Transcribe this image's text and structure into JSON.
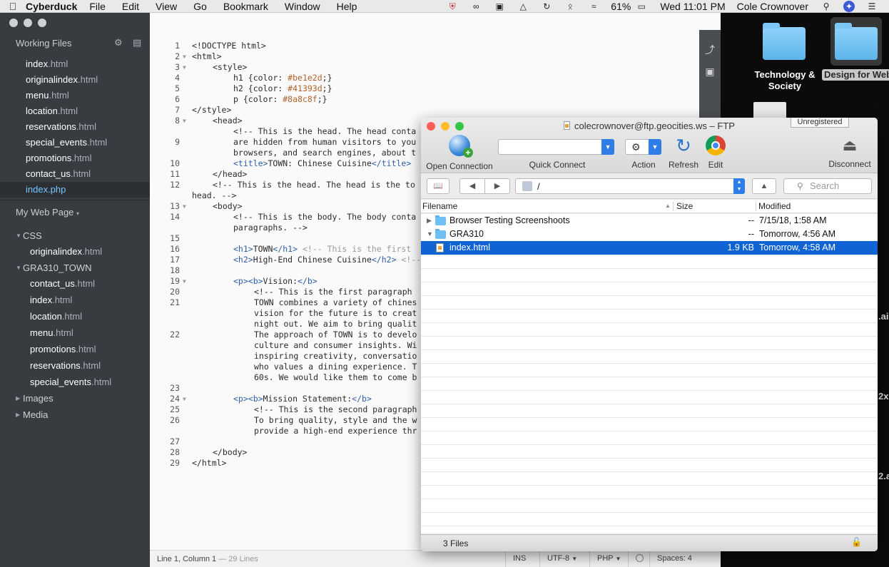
{
  "menubar": {
    "app": "Cyberduck",
    "items": [
      "File",
      "Edit",
      "View",
      "Go",
      "Bookmark",
      "Window",
      "Help"
    ],
    "battery": "61%",
    "clock": "Wed 11:01 PM",
    "user": "Cole Crownover"
  },
  "desktop": {
    "folders": [
      {
        "label_line1": "Technology &",
        "label_line2": "Society"
      },
      {
        "label": "Design for Web"
      }
    ],
    "edge_fragments": [
      ".ai",
      "2x",
      "2.ai"
    ]
  },
  "sidebar": {
    "working_files_title": "Working Files",
    "working_files": [
      {
        "name": "index",
        "ext": ".html"
      },
      {
        "name": "originalindex",
        "ext": ".html"
      },
      {
        "name": "menu",
        "ext": ".html"
      },
      {
        "name": "location",
        "ext": ".html"
      },
      {
        "name": "reservations",
        "ext": ".html"
      },
      {
        "name": "special_events",
        "ext": ".html"
      },
      {
        "name": "promotions",
        "ext": ".html"
      },
      {
        "name": "contact_us",
        "ext": ".html"
      },
      {
        "name": "index",
        "ext": ".php"
      }
    ],
    "project_title": "My Web Page",
    "groups": {
      "css": {
        "label": "CSS",
        "files": [
          {
            "name": "originalindex",
            "ext": ".html"
          }
        ]
      },
      "gra": {
        "label": "GRA310_TOWN",
        "files": [
          {
            "name": "contact_us",
            "ext": ".html"
          },
          {
            "name": "index",
            "ext": ".html"
          },
          {
            "name": "location",
            "ext": ".html"
          },
          {
            "name": "menu",
            "ext": ".html"
          },
          {
            "name": "promotions",
            "ext": ".html"
          },
          {
            "name": "reservations",
            "ext": ".html"
          },
          {
            "name": "special_events",
            "ext": ".html"
          }
        ]
      },
      "images": {
        "label": "Images"
      },
      "media": {
        "label": "Media"
      }
    }
  },
  "code": {
    "l1": "<!DOCTYPE html>",
    "l2": "<html>",
    "l3": "<style>",
    "l4a": "h1 {color: ",
    "l4b": "#be1e2d",
    "l4c": ";}",
    "l5a": "h2 {color: ",
    "l5b": "#41393d",
    "l5c": ";}",
    "l6a": "p {color: ",
    "l6b": "#8a8c8f",
    "l6c": ";}",
    "l7": "</style>",
    "l8": "<head>",
    "l9a": "<!-- This is the head. The head conta",
    "l9b": "are hidden from human visitors to you",
    "l9c": "browsers, and search engines, about t",
    "l10a": "<title>",
    "l10b": "TOWN: Chinese Cuisine",
    "l10c": "</title>",
    "l11": "</head>",
    "l12a": "<!-- This is the head. The head is the to",
    "l12b": "head. -->",
    "l13": "<body>",
    "l14a": "<!-- This is the body. The body conta",
    "l14b": "paragraphs. -->",
    "l16a": "<h1>",
    "l16b": "TOWN",
    "l16c": "</h1>",
    "l16d": " <!-- This is the first",
    "l17a": "<h2>",
    "l17b": "High-End Chinese Cuisine",
    "l17c": "</h2>",
    "l17d": " <!--",
    "l19a": "<p><b>",
    "l19b": "Vision:",
    "l19c": "</b>",
    "l20": "<!-- This is the first paragraph",
    "l21a": "TOWN combines a variety of chines",
    "l21b": "vision for the future is to creat",
    "l21c": "night out. We aim to bring qualit",
    "l22a": "The approach of TOWN is to develo",
    "l22b": "culture and consumer insights. Wi",
    "l22c": "inspiring creativity, conversatio",
    "l22d": "who values a dining experience. T",
    "l22e": "60s. We would like them to come b",
    "l24a": "<p><b>",
    "l24b": "Mission Statement:",
    "l24c": "</b>",
    "l25": "<!-- This is the second paragraph",
    "l26a": "To bring quality, style and the w",
    "l26b": "provide a high-end experience thr",
    "l28": "</body>",
    "l29": "</html>"
  },
  "editor_status": {
    "position": "Line 1, Column 1",
    "lines": "— 29 Lines",
    "mode": "INS",
    "encoding": "UTF-8",
    "syntax": "PHP",
    "spaces": "Spaces:  4"
  },
  "cyberduck": {
    "title": "colecrownover@ftp.geocities.ws – FTP",
    "unregistered": "Unregistered",
    "toolbar": {
      "open_connection": "Open Connection",
      "quick_connect": "Quick Connect",
      "action": "Action",
      "refresh": "Refresh",
      "edit": "Edit",
      "disconnect": "Disconnect"
    },
    "path": "/",
    "search_placeholder": "Search",
    "columns": {
      "filename": "Filename",
      "size": "Size",
      "modified": "Modified"
    },
    "files": [
      {
        "name": "Browser Testing Screenshoots",
        "size": "--",
        "modified": "7/15/18, 1:58 AM"
      },
      {
        "name": "GRA310",
        "size": "--",
        "modified": "Tomorrow, 4:56 AM"
      },
      {
        "name": "index.html",
        "size": "1.9 KB",
        "modified": "Tomorrow, 4:58 AM"
      }
    ],
    "status": "3 Files"
  }
}
